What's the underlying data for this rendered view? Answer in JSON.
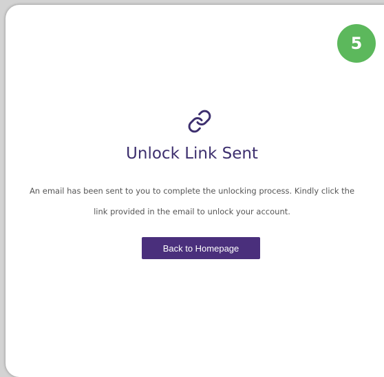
{
  "step": {
    "number": "5"
  },
  "icon": {
    "name": "link-icon"
  },
  "content": {
    "title": "Unlock Link Sent",
    "message": "An email has been sent to you to complete the unlocking process. Kindly click the link provided in the email to unlock your account.",
    "button_label": "Back to Homepage"
  },
  "colors": {
    "accent": "#4a2f7c",
    "title": "#3d2f6e",
    "badge": "#5cb85c",
    "background": "#d3d3d3"
  }
}
